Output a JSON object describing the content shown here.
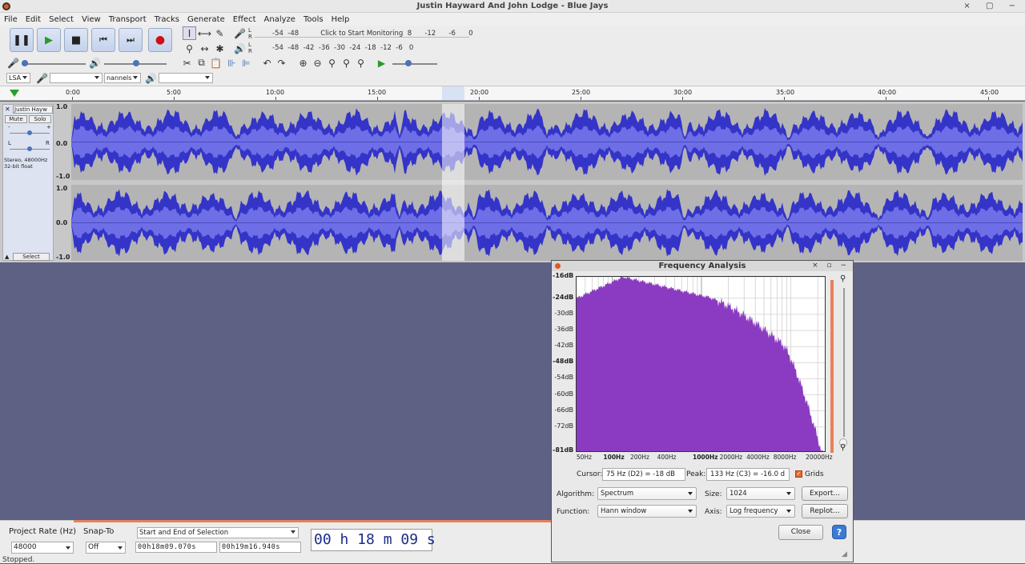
{
  "window": {
    "title": "Justin Hayward And John Lodge - Blue Jays",
    "controls": "× ▢ −"
  },
  "menu": [
    "File",
    "Edit",
    "Select",
    "View",
    "Transport",
    "Tracks",
    "Generate",
    "Effect",
    "Analyze",
    "Tools",
    "Help"
  ],
  "transport": {
    "pause": "pause-icon",
    "play": "play-icon",
    "stop": "stop-icon",
    "skip_start": "skip-start-icon",
    "skip_end": "skip-end-icon",
    "record": "record-icon"
  },
  "meters": {
    "record_scale": "-54  -48          Click to Start Monitoring  8      -12      -6      0",
    "play_scale": "-54  -48  -42  -36  -30  -24  -18  -12  -6   0",
    "lr_top": "L\nR",
    "lr_bottom": "L\nR"
  },
  "device": {
    "host": "LSA",
    "rec_device": "",
    "channels": "nannels",
    "play_device": ""
  },
  "ruler": {
    "ticks": [
      "0:00",
      "5:00",
      "10:00",
      "15:00",
      "20:00",
      "25:00",
      "30:00",
      "35:00",
      "40:00",
      "45:00"
    ]
  },
  "track": {
    "name": "Justin Hayw",
    "mute": "Mute",
    "solo": "Solo",
    "minus": "-",
    "plus": "+",
    "left": "L",
    "right": "R",
    "info_line1": "Stereo, 48000Hz",
    "info_line2": "32-bit float",
    "select": "Select",
    "scale": [
      "1.0",
      "0.0",
      "-1.0"
    ]
  },
  "bottom": {
    "project_rate_label": "Project Rate (Hz)",
    "project_rate": "48000",
    "snap_to_label": "Snap-To",
    "snap_to": "Off",
    "selection_mode": "Start and End of Selection",
    "sel_start": "00h18m09.070s",
    "sel_end": "00h19m16.940s",
    "audio_pos": "00 h 18 m 09 s",
    "status": "Stopped."
  },
  "dialog": {
    "title": "Frequency Analysis",
    "controls": "× ▫ −",
    "y_labels": [
      "-16dB",
      "-24dB",
      "-30dB",
      "-36dB",
      "-42dB",
      "-48dB",
      "-54dB",
      "-60dB",
      "-66dB",
      "-72dB",
      "-81dB"
    ],
    "x_labels": [
      "50Hz",
      "100Hz",
      "200Hz",
      "400Hz",
      "1000Hz",
      "2000Hz",
      "4000Hz",
      "8000Hz",
      "20000Hz"
    ],
    "cursor_label": "Cursor:",
    "cursor_value": "75 Hz (D2) = -18 dB",
    "peak_label": "Peak:",
    "peak_value": "133 Hz (C3) = -16.0 d",
    "grids_label": "Grids",
    "algorithm_label": "Algorithm:",
    "algorithm": "Spectrum",
    "size_label": "Size:",
    "size": "1024",
    "export": "Export...",
    "function_label": "Function:",
    "function": "Hann window",
    "axis_label": "Axis:",
    "axis": "Log frequency",
    "replot": "Replot...",
    "close": "Close",
    "help": "?",
    "spectrum_color": "#8a3bc1"
  },
  "colors": {
    "waveform": "#3434c8",
    "waveform_inner": "#6e6ee6",
    "accent_orange": "#e8805a"
  }
}
